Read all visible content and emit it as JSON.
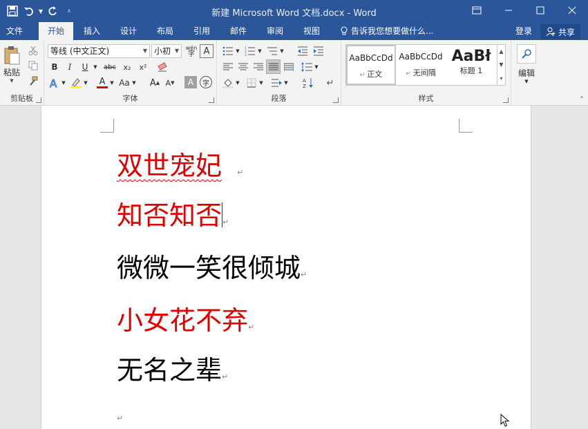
{
  "window": {
    "title": "新建 Microsoft Word 文档.docx - Word"
  },
  "tabs": [
    {
      "label": "文件"
    },
    {
      "label": "开始"
    },
    {
      "label": "插入"
    },
    {
      "label": "设计"
    },
    {
      "label": "布局"
    },
    {
      "label": "引用"
    },
    {
      "label": "邮件"
    },
    {
      "label": "审阅"
    },
    {
      "label": "视图"
    }
  ],
  "active_tab": "开始",
  "tellme": {
    "text": "告诉我您想要做什么..."
  },
  "account": {
    "login": "登录",
    "share": "共享"
  },
  "ribbon": {
    "clipboard": {
      "label": "剪贴板",
      "paste": "粘贴"
    },
    "font": {
      "label": "字体",
      "font_name": "等线 (中文正文)",
      "font_size": "小初",
      "bold": "B",
      "italic": "I",
      "underline": "U",
      "strike": "abc",
      "subscript": "x₂",
      "superscript": "x²",
      "grow": "A",
      "shrink": "A",
      "case": "Aa",
      "shade_char": "A",
      "enclose": "字",
      "phonetic": "wén",
      "border_char": "A"
    },
    "paragraph": {
      "label": "段落"
    },
    "styles": {
      "label": "样式",
      "items": [
        {
          "sample": "AaBbCcDd",
          "name": "正文"
        },
        {
          "sample": "AaBbCcDd",
          "name": "无间隔"
        },
        {
          "sample": "AaBł",
          "name": "标题 1"
        }
      ]
    },
    "editing": {
      "label": "编辑"
    }
  },
  "document": {
    "lines": [
      {
        "text": "双世宠妃",
        "color": "#e00000"
      },
      {
        "text": "知否知否",
        "color": "#e00000"
      },
      {
        "text": "微微一笑很倾城",
        "color": "#000000"
      },
      {
        "text": "小女花不弃",
        "color": "#e00000"
      },
      {
        "text": "无名之辈",
        "color": "#000000"
      }
    ],
    "paragraph_mark": "↵"
  },
  "colors": {
    "brand": "#2b579a",
    "red_text": "#e00000",
    "font_color_bar": "#e00000",
    "highlight_bar": "#ffff00"
  }
}
